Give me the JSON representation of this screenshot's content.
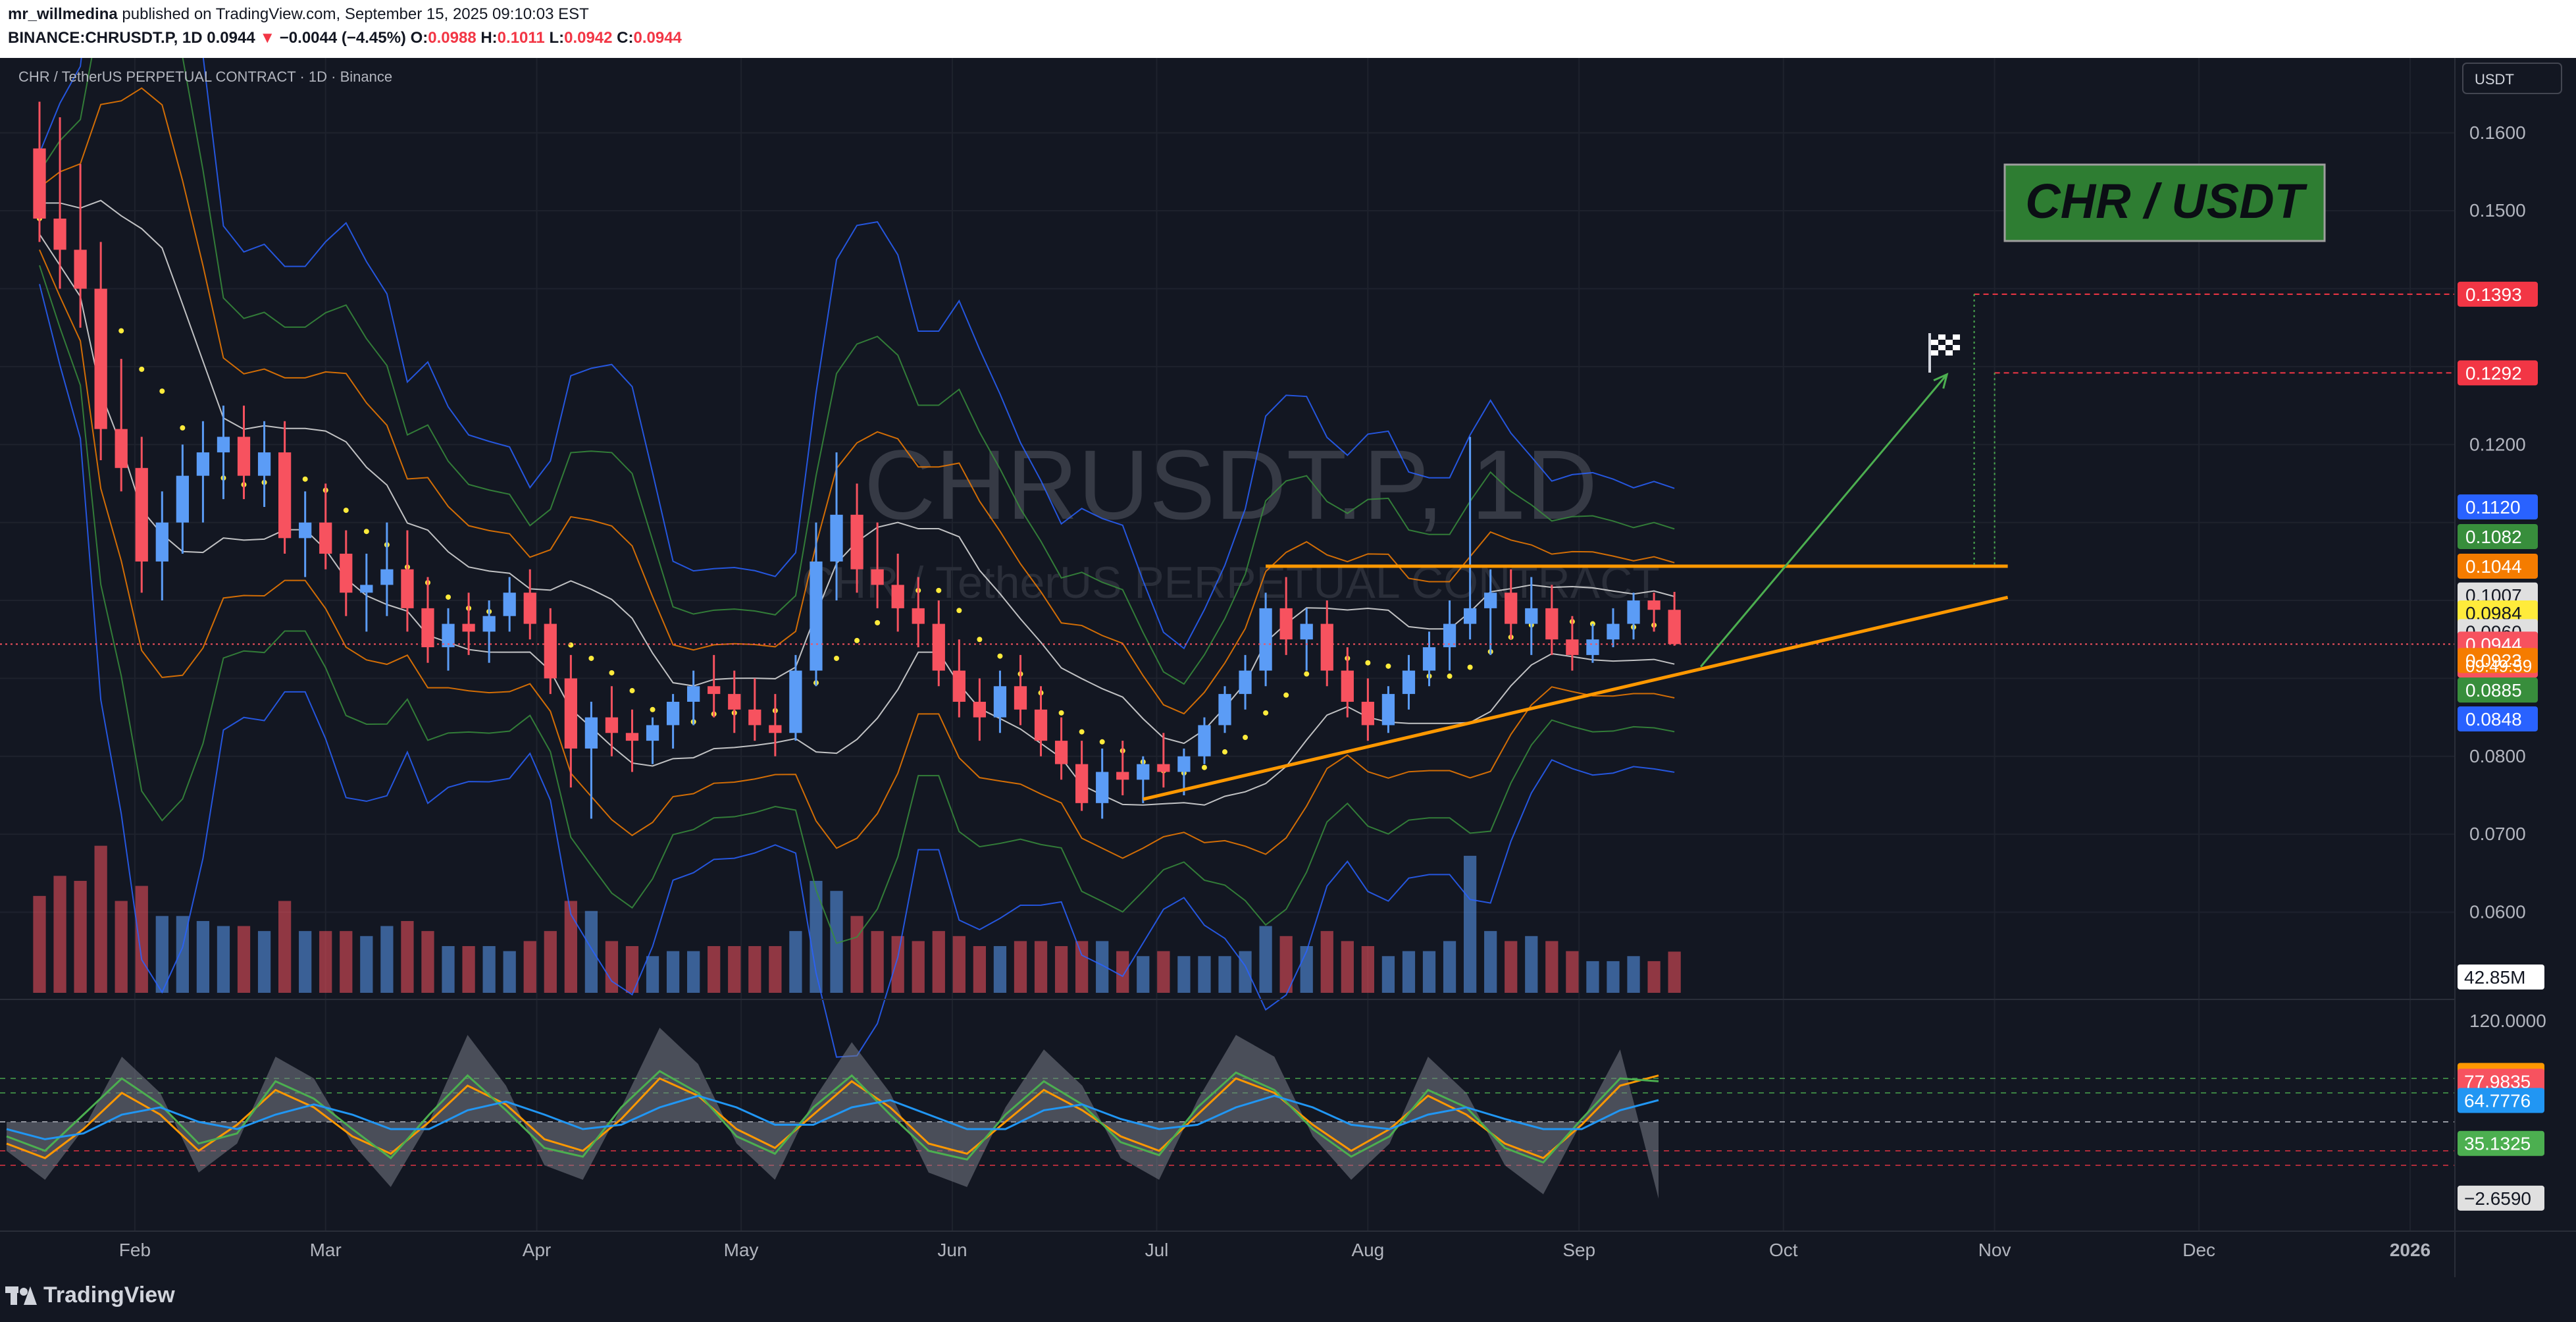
{
  "header": {
    "author": "mr_willmedina",
    "published_text": "published on TradingView.com, September 15, 2025 09:10:03 EST",
    "symbol_line": "BINANCE:CHRUSDT.P, 1D",
    "last": "0.0944",
    "change_arrow": "▼",
    "change": "−0.0044 (−4.45%)",
    "open_label": "O:",
    "open": "0.0988",
    "high_label": "H:",
    "high": "0.1011",
    "low_label": "L:",
    "low": "0.0942",
    "close_label": "C:",
    "close": "0.0944"
  },
  "pane": {
    "legend": "CHR / TetherUS PERPETUAL CONTRACT · 1D · Binance",
    "watermark_symbol": "CHRUSDT.P, 1D",
    "watermark_name": "CHR / TetherUS PERPETUAL CONTRACT",
    "currency_button": "USDT",
    "title_box": "CHR / USDT",
    "volume_label": "42.85M",
    "countdown": "09:49:59"
  },
  "footer": {
    "brand": "TradingView"
  },
  "colors": {
    "background": "#131722",
    "bull": "#5b9cf6",
    "bear": "#f7525f",
    "orange_line": "#ff9800",
    "target_red": "#f23645",
    "title_box_bg": "#2e7d32",
    "yellow_dots": "#ffeb3b",
    "band_white": "#e0e0e0",
    "band_orange": "#f57c00",
    "band_green": "#388e3c",
    "band_blue": "#2962ff"
  },
  "chart_data": {
    "type": "candlestick",
    "price_axis_ticks": [
      "0.1600",
      "0.1500",
      "0.1200",
      "0.0800",
      "0.0700",
      "0.0600"
    ],
    "price_axis_hidden_ticks": [
      "0.1400",
      "0.1300",
      "0.1100",
      "0.1000",
      "0.0900"
    ],
    "ylim": [
      0.0505,
      0.1686
    ],
    "time_ticks": [
      "Feb",
      "Mar",
      "Apr",
      "May",
      "Jun",
      "Jul",
      "Aug",
      "Sep",
      "Oct",
      "Nov",
      "Dec",
      "2026"
    ],
    "time_tick_dates": [
      "2025-02-01",
      "2025-03-01",
      "2025-04-01",
      "2025-05-01",
      "2025-06-01",
      "2025-07-01",
      "2025-08-01",
      "2025-09-01",
      "2025-10-01",
      "2025-11-01",
      "2025-12-01",
      "2026-01-01"
    ],
    "date_range": [
      "2025-01-18",
      "2025-09-15"
    ],
    "ohlc": [
      [
        "2025-01-18",
        0.158,
        0.164,
        0.146,
        0.149
      ],
      [
        "2025-01-21",
        0.149,
        0.162,
        0.14,
        0.145
      ],
      [
        "2025-01-24",
        0.145,
        0.156,
        0.135,
        0.14
      ],
      [
        "2025-01-27",
        0.14,
        0.146,
        0.118,
        0.122
      ],
      [
        "2025-01-30",
        0.122,
        0.131,
        0.114,
        0.117
      ],
      [
        "2025-02-02",
        0.117,
        0.121,
        0.101,
        0.105
      ],
      [
        "2025-02-05",
        0.105,
        0.114,
        0.1,
        0.11
      ],
      [
        "2025-02-08",
        0.11,
        0.12,
        0.106,
        0.116
      ],
      [
        "2025-02-11",
        0.116,
        0.123,
        0.11,
        0.119
      ],
      [
        "2025-02-14",
        0.119,
        0.125,
        0.113,
        0.121
      ],
      [
        "2025-02-17",
        0.121,
        0.125,
        0.113,
        0.116
      ],
      [
        "2025-02-20",
        0.116,
        0.123,
        0.112,
        0.119
      ],
      [
        "2025-02-23",
        0.119,
        0.123,
        0.106,
        0.108
      ],
      [
        "2025-02-26",
        0.108,
        0.114,
        0.103,
        0.11
      ],
      [
        "2025-03-01",
        0.11,
        0.115,
        0.104,
        0.106
      ],
      [
        "2025-03-04",
        0.106,
        0.109,
        0.098,
        0.101
      ],
      [
        "2025-03-07",
        0.101,
        0.106,
        0.096,
        0.102
      ],
      [
        "2025-03-10",
        0.102,
        0.11,
        0.098,
        0.104
      ],
      [
        "2025-03-13",
        0.104,
        0.109,
        0.096,
        0.099
      ],
      [
        "2025-03-16",
        0.099,
        0.103,
        0.092,
        0.094
      ],
      [
        "2025-03-19",
        0.094,
        0.099,
        0.091,
        0.097
      ],
      [
        "2025-03-22",
        0.097,
        0.101,
        0.093,
        0.096
      ],
      [
        "2025-03-25",
        0.096,
        0.1,
        0.092,
        0.098
      ],
      [
        "2025-03-28",
        0.098,
        0.103,
        0.096,
        0.101
      ],
      [
        "2025-03-31",
        0.101,
        0.104,
        0.095,
        0.097
      ],
      [
        "2025-04-03",
        0.097,
        0.099,
        0.088,
        0.09
      ],
      [
        "2025-04-06",
        0.09,
        0.093,
        0.076,
        0.081
      ],
      [
        "2025-04-09",
        0.081,
        0.087,
        0.072,
        0.085
      ],
      [
        "2025-04-12",
        0.085,
        0.089,
        0.08,
        0.083
      ],
      [
        "2025-04-15",
        0.083,
        0.086,
        0.078,
        0.082
      ],
      [
        "2025-04-18",
        0.082,
        0.085,
        0.079,
        0.084
      ],
      [
        "2025-04-21",
        0.084,
        0.088,
        0.081,
        0.087
      ],
      [
        "2025-04-24",
        0.087,
        0.091,
        0.084,
        0.089
      ],
      [
        "2025-04-27",
        0.089,
        0.093,
        0.085,
        0.088
      ],
      [
        "2025-04-30",
        0.088,
        0.091,
        0.083,
        0.086
      ],
      [
        "2025-05-03",
        0.086,
        0.09,
        0.082,
        0.084
      ],
      [
        "2025-05-06",
        0.084,
        0.088,
        0.08,
        0.083
      ],
      [
        "2025-05-09",
        0.083,
        0.093,
        0.082,
        0.091
      ],
      [
        "2025-05-12",
        0.091,
        0.11,
        0.089,
        0.105
      ],
      [
        "2025-05-15",
        0.105,
        0.119,
        0.1,
        0.111
      ],
      [
        "2025-05-18",
        0.111,
        0.115,
        0.101,
        0.104
      ],
      [
        "2025-05-21",
        0.104,
        0.11,
        0.099,
        0.102
      ],
      [
        "2025-05-24",
        0.102,
        0.106,
        0.096,
        0.099
      ],
      [
        "2025-05-27",
        0.099,
        0.103,
        0.094,
        0.097
      ],
      [
        "2025-05-30",
        0.097,
        0.1,
        0.089,
        0.091
      ],
      [
        "2025-06-02",
        0.091,
        0.095,
        0.085,
        0.087
      ],
      [
        "2025-06-05",
        0.087,
        0.09,
        0.082,
        0.085
      ],
      [
        "2025-06-08",
        0.085,
        0.091,
        0.083,
        0.089
      ],
      [
        "2025-06-11",
        0.089,
        0.093,
        0.084,
        0.086
      ],
      [
        "2025-06-14",
        0.086,
        0.089,
        0.08,
        0.082
      ],
      [
        "2025-06-17",
        0.082,
        0.085,
        0.077,
        0.079
      ],
      [
        "2025-06-20",
        0.079,
        0.082,
        0.073,
        0.074
      ],
      [
        "2025-06-23",
        0.074,
        0.081,
        0.072,
        0.078
      ],
      [
        "2025-06-26",
        0.078,
        0.082,
        0.075,
        0.077
      ],
      [
        "2025-06-29",
        0.077,
        0.08,
        0.074,
        0.079
      ],
      [
        "2025-07-02",
        0.079,
        0.083,
        0.076,
        0.078
      ],
      [
        "2025-07-05",
        0.078,
        0.081,
        0.075,
        0.08
      ],
      [
        "2025-07-08",
        0.08,
        0.085,
        0.079,
        0.084
      ],
      [
        "2025-07-11",
        0.084,
        0.089,
        0.083,
        0.088
      ],
      [
        "2025-07-14",
        0.088,
        0.093,
        0.086,
        0.091
      ],
      [
        "2025-07-17",
        0.091,
        0.101,
        0.089,
        0.099
      ],
      [
        "2025-07-20",
        0.099,
        0.103,
        0.093,
        0.095
      ],
      [
        "2025-07-23",
        0.095,
        0.099,
        0.091,
        0.097
      ],
      [
        "2025-07-26",
        0.097,
        0.1,
        0.089,
        0.091
      ],
      [
        "2025-07-29",
        0.091,
        0.094,
        0.085,
        0.087
      ],
      [
        "2025-08-01",
        0.087,
        0.09,
        0.082,
        0.084
      ],
      [
        "2025-08-04",
        0.084,
        0.089,
        0.083,
        0.088
      ],
      [
        "2025-08-07",
        0.088,
        0.093,
        0.086,
        0.091
      ],
      [
        "2025-08-10",
        0.091,
        0.096,
        0.089,
        0.094
      ],
      [
        "2025-08-13",
        0.094,
        0.1,
        0.091,
        0.097
      ],
      [
        "2025-08-16",
        0.097,
        0.121,
        0.095,
        0.099
      ],
      [
        "2025-08-19",
        0.099,
        0.104,
        0.093,
        0.101
      ],
      [
        "2025-08-22",
        0.101,
        0.104,
        0.095,
        0.097
      ],
      [
        "2025-08-25",
        0.097,
        0.103,
        0.093,
        0.099
      ],
      [
        "2025-08-28",
        0.099,
        0.102,
        0.093,
        0.095
      ],
      [
        "2025-08-31",
        0.095,
        0.098,
        0.091,
        0.093
      ],
      [
        "2025-09-03",
        0.093,
        0.097,
        0.092,
        0.095
      ],
      [
        "2025-09-06",
        0.095,
        0.099,
        0.094,
        0.097
      ],
      [
        "2025-09-09",
        0.097,
        0.101,
        0.095,
        0.1
      ],
      [
        "2025-09-12",
        0.1,
        0.101,
        0.096,
        0.0988
      ],
      [
        "2025-09-15",
        0.0988,
        0.1011,
        0.0942,
        0.0944
      ]
    ],
    "price_labels": [
      {
        "value": 0.1393,
        "text": "0.1393",
        "color": "#f23645"
      },
      {
        "value": 0.1292,
        "text": "0.1292",
        "color": "#f23645"
      },
      {
        "value": 0.112,
        "text": "0.1120",
        "color": "#2962ff"
      },
      {
        "value": 0.1082,
        "text": "0.1082",
        "color": "#388e3c"
      },
      {
        "value": 0.1044,
        "text": "0.1044",
        "color": "#f57c00"
      },
      {
        "value": 0.1007,
        "text": "0.1007",
        "color": "#e0e0e0"
      },
      {
        "value": 0.0984,
        "text": "0.0984",
        "color": "#ffeb3b"
      },
      {
        "value": 0.096,
        "text": "0.0960",
        "color": "#e0e0e0"
      },
      {
        "value": 0.0944,
        "text": "0.0944",
        "color": "#f7525f"
      },
      {
        "value": 0.0923,
        "text": "0.0923",
        "color": "#f57c00"
      },
      {
        "value": 0.0885,
        "text": "0.0885",
        "color": "#388e3c"
      },
      {
        "value": 0.0848,
        "text": "0.0848",
        "color": "#2962ff"
      }
    ],
    "resistance": {
      "value": 0.1044,
      "from": "2025-07-17",
      "to": "2025-11-01"
    },
    "support_trendline": {
      "from": [
        "2025-06-29",
        0.0745
      ],
      "to": [
        "2025-11-01",
        0.1004
      ]
    },
    "projection_arrow": {
      "from": [
        "2025-09-15",
        0.0915
      ],
      "to": [
        "2025-10-25",
        0.129
      ]
    },
    "targets": [
      {
        "value": 0.1393,
        "from": "2025-10-29"
      },
      {
        "value": 0.1292,
        "from": "2025-11-01"
      }
    ],
    "oscillator": {
      "ticks": [
        "120.0000"
      ],
      "labels": [
        {
          "text": "82.0484",
          "color": "#ff9800"
        },
        {
          "text": "77.9835",
          "color": "#f7525f"
        },
        {
          "text": "64.7776",
          "color": "#2196f3"
        },
        {
          "text": "35.1325",
          "color": "#4caf50"
        },
        {
          "text": "−2.6590",
          "color": "#e0e0e0"
        }
      ],
      "label_values": [
        82.0484,
        77.9835,
        64.7776,
        35.1325,
        -2.659
      ],
      "range": [
        -20,
        130
      ],
      "levels": [
        80,
        70,
        50,
        30,
        20
      ],
      "series": [
        {
          "color": "#ff9800",
          "values": [
            35,
            25,
            45,
            70,
            55,
            30,
            48,
            72,
            60,
            40,
            28,
            50,
            75,
            62,
            38,
            30,
            52,
            80,
            68,
            45,
            32,
            55,
            78,
            60,
            35,
            28,
            50,
            72,
            58,
            40,
            30,
            55,
            80,
            70,
            48,
            30,
            45,
            68,
            55,
            35,
            25,
            48,
            75,
            82
          ]
        },
        {
          "color": "#4caf50",
          "values": [
            40,
            30,
            55,
            80,
            62,
            35,
            42,
            78,
            66,
            45,
            25,
            55,
            82,
            58,
            32,
            26,
            60,
            85,
            70,
            40,
            28,
            60,
            82,
            55,
            30,
            24,
            55,
            78,
            62,
            36,
            27,
            60,
            84,
            72,
            45,
            26,
            40,
            72,
            60,
            32,
            22,
            52,
            80,
            78
          ]
        },
        {
          "color": "#2196f3",
          "values": [
            45,
            38,
            42,
            55,
            60,
            50,
            45,
            55,
            62,
            55,
            45,
            45,
            58,
            64,
            55,
            45,
            48,
            60,
            68,
            60,
            48,
            48,
            60,
            65,
            55,
            45,
            45,
            58,
            62,
            52,
            45,
            48,
            60,
            68,
            60,
            48,
            45,
            55,
            60,
            52,
            45,
            45,
            58,
            65
          ]
        },
        {
          "color": "#9e9e9e",
          "values": [
            30,
            10,
            45,
            95,
            70,
            15,
            35,
            95,
            80,
            35,
            5,
            50,
            110,
            75,
            20,
            10,
            60,
            115,
            90,
            35,
            10,
            65,
            105,
            70,
            15,
            5,
            60,
            100,
            75,
            25,
            10,
            65,
            110,
            95,
            40,
            10,
            35,
            95,
            70,
            20,
            0,
            50,
            100,
            -3
          ]
        }
      ]
    }
  }
}
